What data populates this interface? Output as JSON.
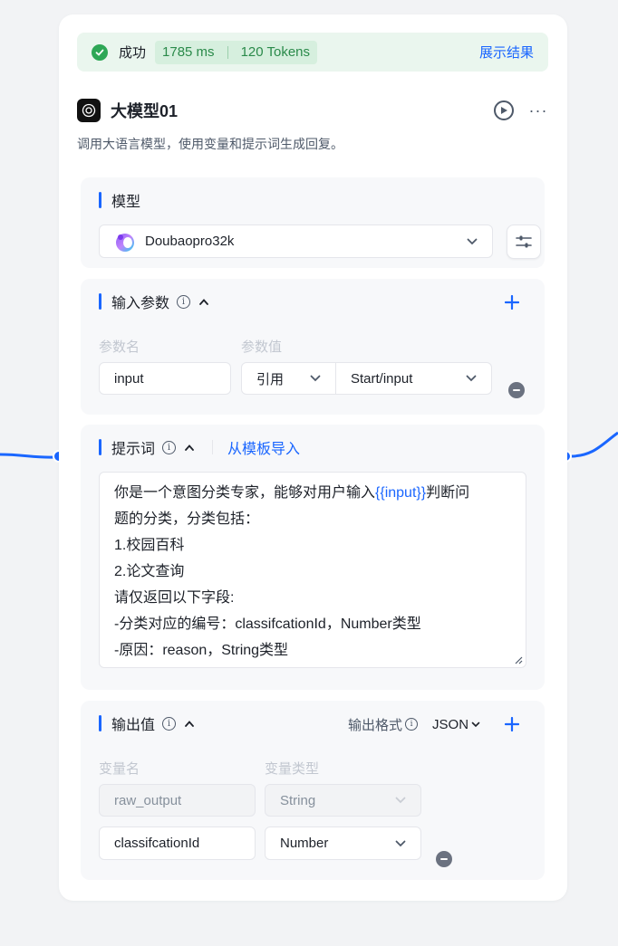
{
  "status": {
    "text": "成功",
    "duration": "1785 ms",
    "tokens": "120 Tokens",
    "show_result": "展示结果",
    "color": "#2ea756"
  },
  "node": {
    "title": "大模型01",
    "description": "调用大语言模型，使用变量和提示词生成回复。",
    "more": "···"
  },
  "model": {
    "section_label": "模型",
    "selected": "Doubaopro32k"
  },
  "input_params": {
    "section_label": "输入参数",
    "col_name": "参数名",
    "col_value": "参数值",
    "rows": [
      {
        "name": "input",
        "type": "引用",
        "value": "Start/input"
      }
    ]
  },
  "prompt": {
    "section_label": "提示词",
    "import_link": "从模板导入",
    "line1_before": "你是一个意图分类专家，能够对用户输入",
    "line1_var": "{{input}}",
    "line1_after": "判断问",
    "line2": "题的分类，分类包括：",
    "line3": "1.校园百科",
    "line4": "2.论文查询",
    "line5": "请仅返回以下字段:",
    "line6": "-分类对应的编号：classifcationId，Number类型",
    "line7": "-原因：reason，String类型"
  },
  "output": {
    "section_label": "输出值",
    "format_label": "输出格式",
    "format_value": "JSON",
    "col_name": "变量名",
    "col_type": "变量类型",
    "rows": [
      {
        "name": "raw_output",
        "type": "String"
      },
      {
        "name": "classifcationId",
        "type": "Number"
      }
    ]
  },
  "colors": {
    "accent": "#1a66ff",
    "success": "#2ea756"
  }
}
